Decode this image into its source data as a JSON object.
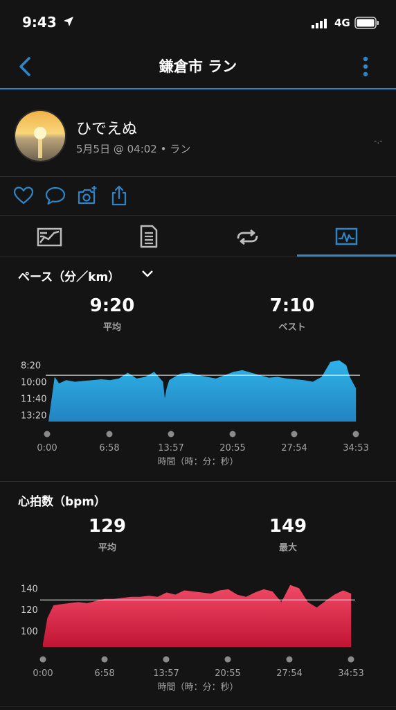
{
  "status_bar": {
    "time": "9:43",
    "network": "4G"
  },
  "nav": {
    "title": "鎌倉市 ラン"
  },
  "profile": {
    "name": "ひでえぬ",
    "meta": "5月5日 @ 04:02 • ラン",
    "side_mark": "-.-"
  },
  "actions": [
    "heart-icon",
    "comment-icon",
    "add-photo-icon",
    "share-icon"
  ],
  "tabs": [
    "map-tab",
    "details-tab",
    "laps-tab",
    "charts-tab"
  ],
  "pace": {
    "title": "ペース（分／km）",
    "avg_value": "9:20",
    "avg_label": "平均",
    "best_value": "7:10",
    "best_label": "ベスト"
  },
  "heart": {
    "title": "心拍数（bpm）",
    "avg_value": "129",
    "avg_label": "平均",
    "max_value": "149",
    "max_label": "最大"
  },
  "time_axis_label": "時間（時：分：秒）",
  "chart_data": [
    {
      "type": "area",
      "title": "ペース（分／km）",
      "xlabel": "時間（時：分：秒）",
      "x_ticks": [
        "0:00",
        "6:58",
        "13:57",
        "20:55",
        "27:54",
        "34:53"
      ],
      "y_ticks": [
        "8:20",
        "10:00",
        "11:40",
        "13:20"
      ],
      "y_ticks_seconds": [
        500,
        600,
        700,
        800
      ],
      "ylim_seconds": [
        840,
        430
      ],
      "average_line_seconds": 560,
      "color": "#2ba8e0",
      "x_minutes": [
        0,
        0.7,
        1.2,
        2,
        3,
        4,
        5,
        6,
        7,
        8,
        9,
        10,
        11,
        12,
        13,
        13.2,
        13.4,
        13.7,
        14,
        15,
        16,
        17,
        18,
        19,
        20,
        21,
        22,
        23,
        24,
        25,
        26,
        27,
        28,
        29,
        30,
        31,
        32,
        33,
        33.8,
        34.2,
        34.9
      ],
      "y_seconds": [
        840,
        570,
        610,
        590,
        600,
        595,
        590,
        585,
        590,
        580,
        545,
        580,
        570,
        540,
        600,
        700,
        640,
        590,
        580,
        550,
        545,
        560,
        570,
        580,
        560,
        540,
        530,
        545,
        560,
        575,
        570,
        580,
        585,
        590,
        600,
        570,
        480,
        470,
        500,
        570,
        640
      ]
    },
    {
      "type": "area",
      "title": "心拍数（bpm）",
      "xlabel": "時間（時：分：秒）",
      "x_ticks": [
        "0:00",
        "6:58",
        "13:57",
        "20:55",
        "27:54",
        "34:53"
      ],
      "y_ticks": [
        100,
        120,
        140
      ],
      "ylim": [
        85,
        150
      ],
      "average_line": 129,
      "color": "#e8304f",
      "x_minutes": [
        0,
        0.5,
        1.2,
        2,
        3,
        4,
        5,
        6,
        7,
        8,
        9,
        10,
        11,
        12,
        13,
        14,
        15,
        16,
        17,
        18,
        19,
        20,
        21,
        22,
        23,
        24,
        25,
        26,
        27,
        28,
        29,
        30,
        31,
        32,
        33,
        34,
        34.9
      ],
      "y_values": [
        88,
        112,
        124,
        125,
        126,
        127,
        126,
        128,
        130,
        130,
        131,
        132,
        132,
        133,
        132,
        136,
        134,
        138,
        137,
        136,
        135,
        138,
        139,
        134,
        132,
        136,
        139,
        137,
        127,
        143,
        140,
        127,
        122,
        128,
        134,
        138,
        135
      ]
    }
  ]
}
